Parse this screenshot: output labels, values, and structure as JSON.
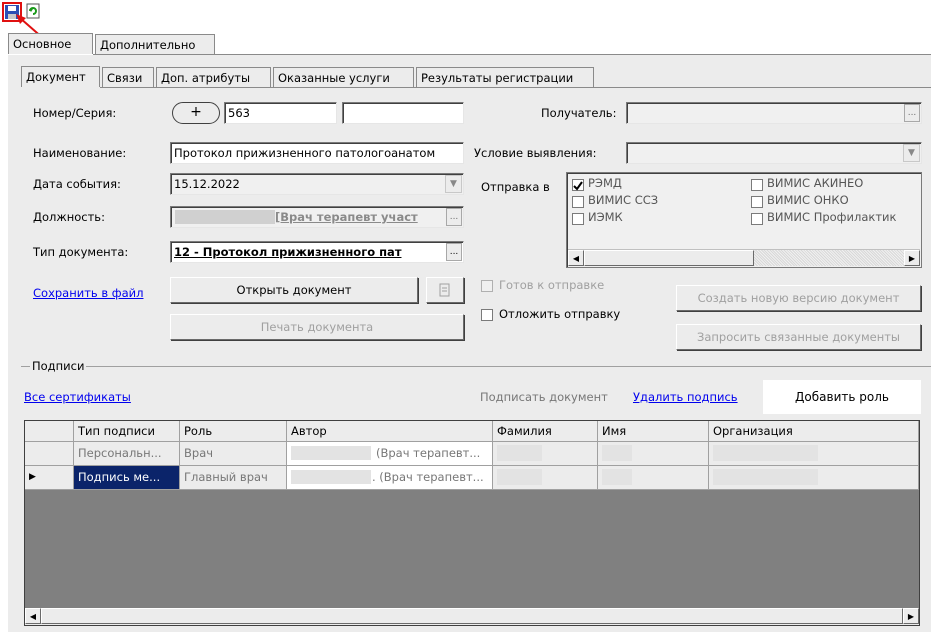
{
  "toolbar": {
    "save_icon": "save-icon",
    "refresh_icon": "refresh-icon"
  },
  "outer_tabs": [
    {
      "label": "Основное"
    },
    {
      "label": "Дополнительно"
    }
  ],
  "inner_tabs": [
    {
      "label": "Документ"
    },
    {
      "label": "Связи"
    },
    {
      "label": "Доп. атрибуты"
    },
    {
      "label": "Оказанные услуги"
    },
    {
      "label": "Результаты регистрации"
    }
  ],
  "form": {
    "number_label": "Номер/Серия:",
    "plus_label": "+",
    "number_value": "563",
    "series_value": "",
    "name_label": "Наименование:",
    "name_value": "Протокол прижизненного патологоанатом",
    "event_date_label": "Дата события:",
    "event_date_value": "15.12.2022",
    "position_label": "Должность:",
    "position_value": "[Врач терапевт участ",
    "doc_type_label": "Тип документа:",
    "doc_type_value": "12 - Протокол прижизненного пат",
    "recipient_label": "Получатель:",
    "recipient_value": "",
    "condition_label": "Условие выявления:",
    "condition_value": "",
    "send_to_label": "Отправка в",
    "send_options": [
      {
        "label": "РЭМД",
        "checked": true
      },
      {
        "label": "ВИМИС АКИНЕО",
        "checked": false
      },
      {
        "label": "ВИМИС ССЗ",
        "checked": false
      },
      {
        "label": "ВИМИС ОНКО",
        "checked": false
      },
      {
        "label": "ИЭМК",
        "checked": false
      },
      {
        "label": "ВИМИС Профилактик",
        "checked": false
      }
    ]
  },
  "actions": {
    "save_to_file": "Сохранить в файл",
    "open_document": "Открыть документ",
    "print_document": "Печать документа",
    "ready_to_send": "Готов к отправке",
    "postpone_send": "Отложить отправку",
    "create_new_version": "Создать новую  версию документ",
    "request_related": "Запросить связанные документы"
  },
  "signatures": {
    "section_title": "Подписи",
    "all_certificates": "Все сертификаты",
    "sign_document": "Подписать документ",
    "delete_signature": "Удалить подпись",
    "add_role": "Добавить роль",
    "columns": [
      "Тип подписи",
      "Роль",
      "Автор",
      "Фамилия",
      "Имя",
      "Организация"
    ],
    "rows": [
      {
        "type": "Персональн...",
        "role": "Врач",
        "author": "(Врач терапевт...",
        "surname": "",
        "name": "",
        "org": ""
      },
      {
        "type": "Подпись ме...",
        "role": "Главный врач",
        "author": ". (Врач терапевт...",
        "surname": "",
        "name": "",
        "org": ""
      }
    ]
  }
}
